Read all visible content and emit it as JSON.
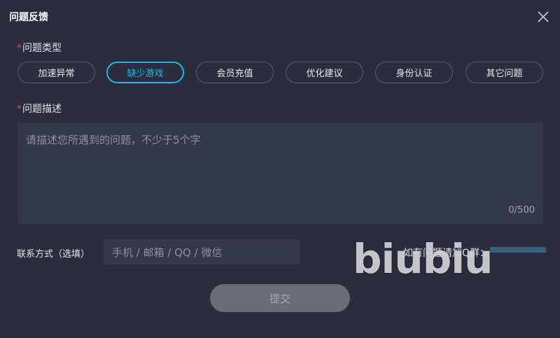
{
  "dialog": {
    "title": "问题反馈"
  },
  "problem_type": {
    "required_mark": "*",
    "label": "问题类型",
    "options": [
      "加速异常",
      "缺少游戏",
      "会员充值",
      "优化建议",
      "身份认证",
      "其它问题"
    ],
    "selected": "缺少游戏"
  },
  "description": {
    "required_mark": "*",
    "label": "问题描述",
    "placeholder": "请描述您所遇到的问题，不少于5个字",
    "counter": "0/500"
  },
  "contact": {
    "label": "联系方式（选填）",
    "placeholder": "手机 / 邮箱 / QQ / 微信",
    "group_text": "如有问题请加Q群："
  },
  "watermark": "biubiu",
  "submit_label": "提交",
  "colors": {
    "background": "#2b2c3d",
    "accent": "#1fb6e6",
    "required": "#e0454f"
  }
}
